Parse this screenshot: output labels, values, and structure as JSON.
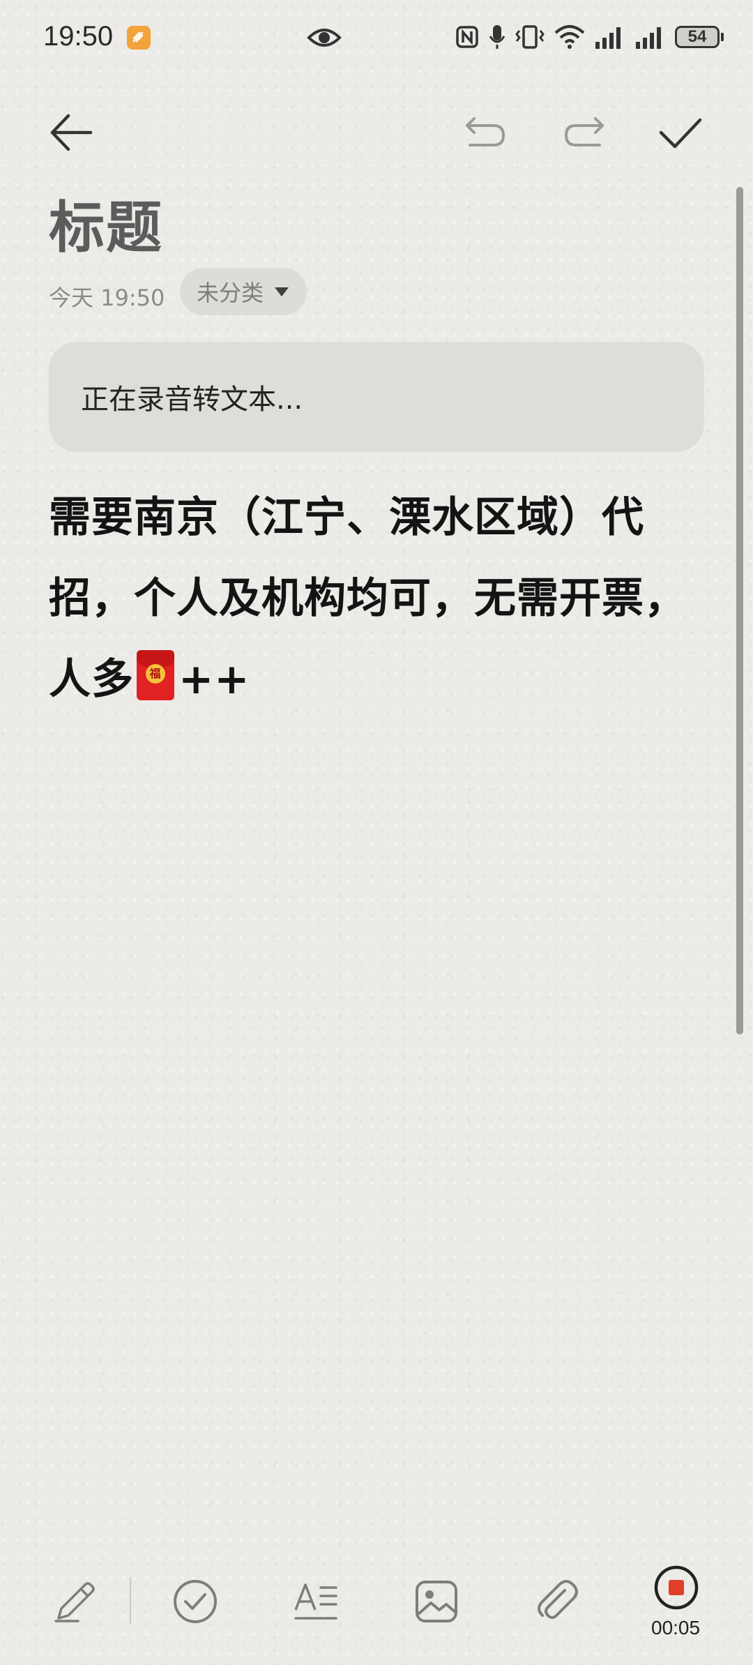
{
  "status_bar": {
    "time": "19:50",
    "battery": "54",
    "icons": [
      "app-badge-icon",
      "eye-icon",
      "nfc-icon",
      "mic-icon",
      "vibrate-icon",
      "wifi-icon",
      "signal-icon",
      "signal-icon",
      "battery-icon"
    ]
  },
  "toolbar": {
    "icons": [
      "back-arrow-icon",
      "undo-icon",
      "redo-icon",
      "check-icon"
    ]
  },
  "note": {
    "title": "标题",
    "date": "今天 19:50",
    "category": "未分类",
    "transcribing_text": "正在录音转文本...",
    "body_before_emoji": "需要南京（江宁、溧水区域）代招，个人及机构均可，无需开票，人多",
    "body_after_emoji": "++",
    "emoji_glyph": "福"
  },
  "bottom_toolbar": {
    "icons": [
      "pen-icon",
      "checklist-icon",
      "text-format-icon",
      "image-icon",
      "attachment-icon",
      "record-stop-icon"
    ],
    "record_time": "00:05"
  },
  "colors": {
    "background": "#ecebe7",
    "recording_red": "#e0402a",
    "app_badge": "#f2a33a"
  }
}
